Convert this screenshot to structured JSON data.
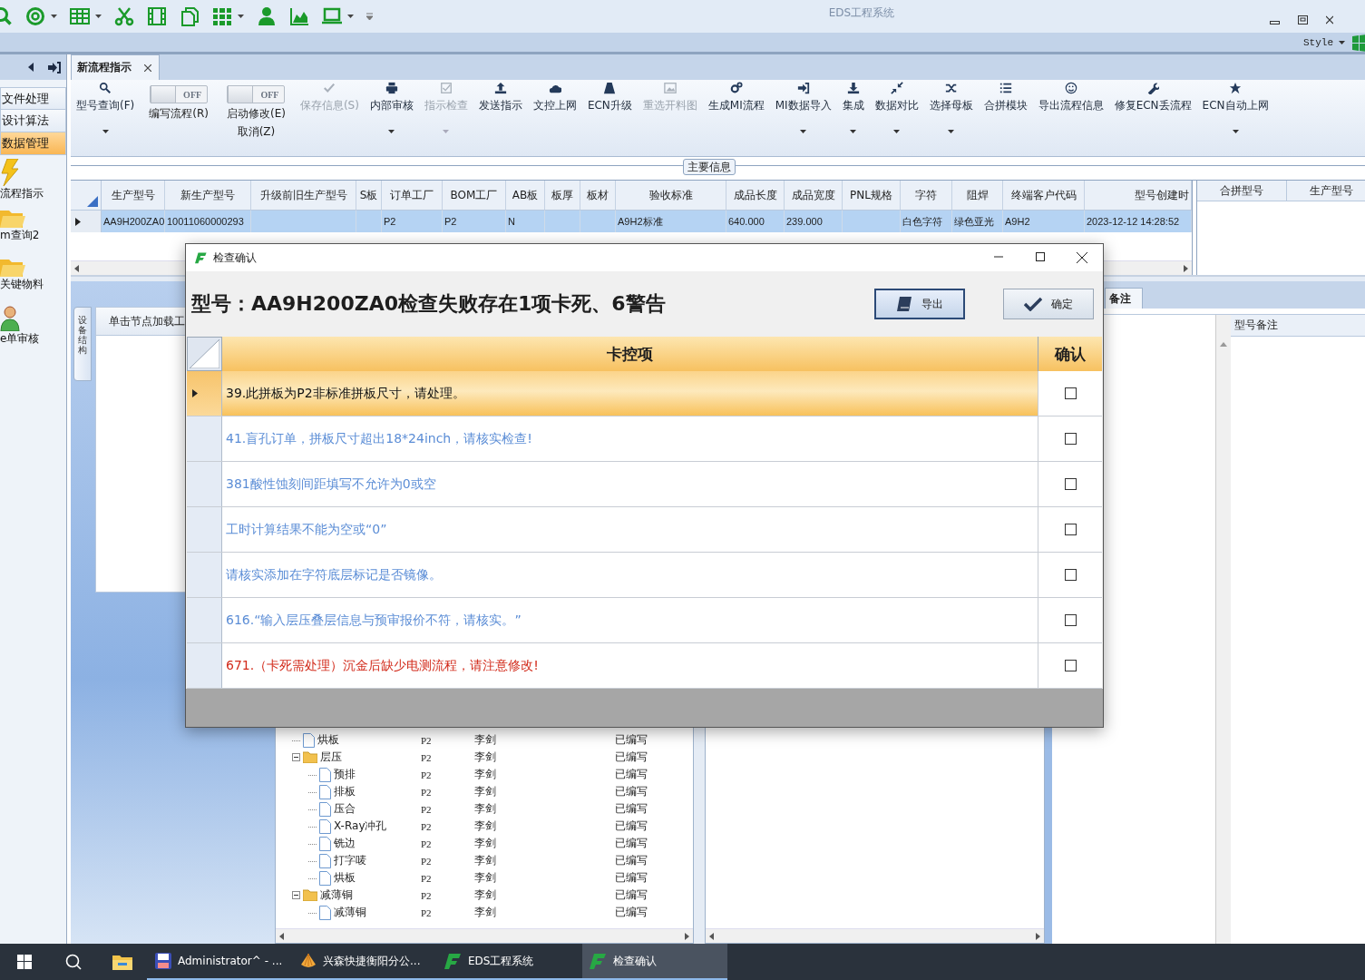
{
  "window": {
    "title": "EDS工程系统",
    "style_menu": "Style"
  },
  "nav_tabs": [
    {
      "label": "新流程指示",
      "selected": true
    }
  ],
  "sidebar": {
    "sections": [
      {
        "label": "文件处理",
        "selected": false
      },
      {
        "label": "设计算法",
        "selected": false
      },
      {
        "label": "数据管理",
        "selected": true
      }
    ],
    "shortcuts": [
      {
        "label": "流程指示"
      },
      {
        "label": "m查询2"
      },
      {
        "label": "关键物料"
      },
      {
        "label": "e单审核"
      }
    ]
  },
  "ribbon": [
    {
      "kind": "button",
      "label": "型号查询(F)",
      "disabled": false,
      "dropdown": true
    },
    {
      "kind": "toggle",
      "label": "编写流程(R)",
      "state": "OFF",
      "on": false
    },
    {
      "kind": "toggle",
      "label": "启动修改(E)",
      "sublabel": "取消(Z)",
      "state": "OFF",
      "on": false
    },
    {
      "kind": "button",
      "label": "保存信息(S)",
      "disabled": true,
      "dropdown": false
    },
    {
      "kind": "button",
      "label": "内部审核",
      "disabled": false,
      "dropdown": true
    },
    {
      "kind": "button",
      "label": "指示检查",
      "disabled": true,
      "dropdown": true
    },
    {
      "kind": "button",
      "label": "发送指示",
      "disabled": false,
      "dropdown": false
    },
    {
      "kind": "button",
      "label": "文控上网",
      "disabled": false,
      "dropdown": false
    },
    {
      "kind": "button",
      "label": "ECN升级",
      "disabled": false,
      "dropdown": false
    },
    {
      "kind": "button",
      "label": "重选开料图",
      "disabled": true,
      "dropdown": false
    },
    {
      "kind": "button",
      "label": "生成MI流程",
      "disabled": false,
      "dropdown": false
    },
    {
      "kind": "button",
      "label": "MI数据导入",
      "disabled": false,
      "dropdown": true
    },
    {
      "kind": "button",
      "label": "集成",
      "disabled": false,
      "dropdown": true
    },
    {
      "kind": "button",
      "label": "数据对比",
      "disabled": false,
      "dropdown": true
    },
    {
      "kind": "button",
      "label": "选择母板",
      "disabled": false,
      "dropdown": true
    },
    {
      "kind": "button",
      "label": "合拼模块",
      "disabled": false,
      "dropdown": false
    },
    {
      "kind": "button",
      "label": "导出流程信息",
      "disabled": false,
      "dropdown": false
    },
    {
      "kind": "button",
      "label": "修复ECN丢流程",
      "disabled": false,
      "dropdown": false
    },
    {
      "kind": "button",
      "label": "ECN自动上网",
      "disabled": false,
      "dropdown": true
    }
  ],
  "main_info": {
    "title": "主要信息",
    "columns": [
      "生产型号",
      "新生产型号",
      "升级前旧生产型号",
      "S板",
      "订单工厂",
      "BOM工厂",
      "AB板",
      "板厚",
      "板材",
      "验收标准",
      "成品长度",
      "成品宽度",
      "PNL规格",
      "字符",
      "阻焊",
      "终端客户代码",
      "型号创建时"
    ],
    "rows": [
      {
        "selected": true,
        "cells": [
          "AA9H200ZA0",
          "10011060000293",
          "",
          "",
          "P2",
          "P2",
          "N",
          "",
          "",
          "A9H2标准",
          "640.000",
          "239.000",
          "",
          "白色字符",
          "绿色亚光",
          "A9H2",
          "2023-12-12 14:28:52"
        ]
      }
    ]
  },
  "merge_table": {
    "columns": [
      "合拼型号",
      "生产型号"
    ]
  },
  "lower": {
    "side_tab": "设备结构",
    "panel_header": "单击节点加载工",
    "tree": [
      {
        "kind": "file",
        "name": "烘板",
        "factory": "P2",
        "person": "李剑",
        "status": "已编写"
      },
      {
        "kind": "folder",
        "name": "层压",
        "factory": "P2",
        "person": "李剑",
        "status": "已编写",
        "expanded": true,
        "children": [
          {
            "kind": "file",
            "name": "预排",
            "factory": "P2",
            "person": "李剑",
            "status": "已编写"
          },
          {
            "kind": "file",
            "name": "排板",
            "factory": "P2",
            "person": "李剑",
            "status": "已编写"
          },
          {
            "kind": "file",
            "name": "压合",
            "factory": "P2",
            "person": "李剑",
            "status": "已编写"
          },
          {
            "kind": "file",
            "name": "X-Ray冲孔",
            "factory": "P2",
            "person": "李剑",
            "status": "已编写"
          },
          {
            "kind": "file",
            "name": "铣边",
            "factory": "P2",
            "person": "李剑",
            "status": "已编写"
          },
          {
            "kind": "file",
            "name": "打字唛",
            "factory": "P2",
            "person": "李剑",
            "status": "已编写"
          },
          {
            "kind": "file",
            "name": "烘板",
            "factory": "P2",
            "person": "李剑",
            "status": "已编写"
          }
        ]
      },
      {
        "kind": "folder",
        "name": "减薄铜",
        "factory": "P2",
        "person": "李剑",
        "status": "已编写",
        "expanded": true,
        "children": [
          {
            "kind": "file",
            "name": "减薄铜",
            "factory": "P2",
            "person": "李剑",
            "status": "已编写"
          }
        ]
      }
    ],
    "notes_tab": "备注",
    "notes_column": "型号备注"
  },
  "dialog": {
    "title": "检查确认",
    "message": "型号：AA9H200ZA0检查失败存在1项卡死、6警告",
    "buttons": [
      {
        "label": "导出",
        "focused": true
      },
      {
        "label": "确定",
        "focused": false
      }
    ],
    "columns": [
      "卡控项",
      "确认"
    ],
    "rows": [
      {
        "text": "39.此拼板为P2非标准拼板尺寸，请处理。",
        "kind": "warning",
        "selected": true,
        "checked": false
      },
      {
        "text": "41.盲孔订单，拼板尺寸超出18*24inch，请核实检查!",
        "kind": "warning",
        "selected": false,
        "checked": false
      },
      {
        "text": "381酸性蚀刻间距填写不允许为0或空",
        "kind": "warning",
        "selected": false,
        "checked": false
      },
      {
        "text": "工时计算结果不能为空或“0”",
        "kind": "warning",
        "selected": false,
        "checked": false
      },
      {
        "text": "请核实添加在字符底层标记是否镜像。",
        "kind": "warning",
        "selected": false,
        "checked": false
      },
      {
        "text": "616.“输入层压叠层信息与预审报价不符，请核实。”",
        "kind": "warning",
        "selected": false,
        "checked": false
      },
      {
        "text": "671.（卡死需处理）沉金后缺少电测流程，请注意修改!",
        "kind": "block",
        "selected": false,
        "checked": false
      }
    ]
  },
  "taskbar": {
    "items": [
      {
        "label": "Administrator^ - ...",
        "selected": false
      },
      {
        "label": "兴森快捷衡阳分公...",
        "selected": false
      },
      {
        "label": "EDS工程系统",
        "selected": false
      },
      {
        "label": "检查确认",
        "selected": true
      }
    ]
  }
}
